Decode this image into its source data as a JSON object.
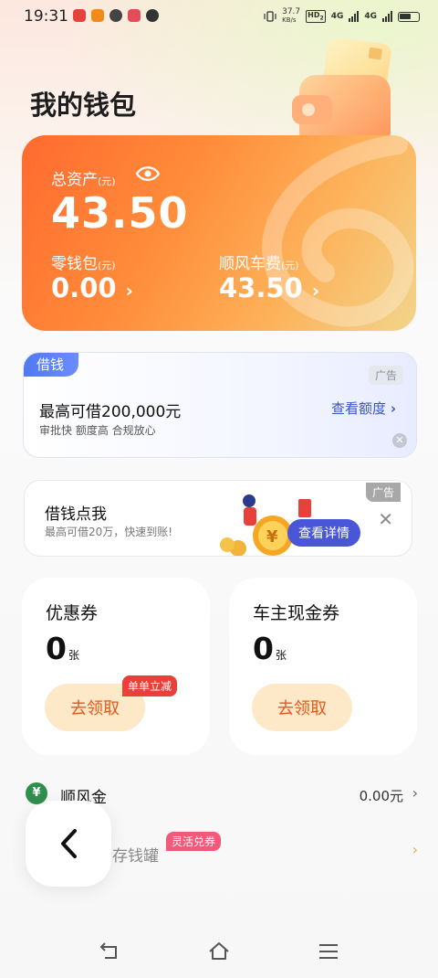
{
  "status_bar": {
    "time": "19:31",
    "net_speed": "37.7",
    "net_unit": "KB/s",
    "hd": "HD",
    "hd_sub": "2",
    "sim1": "4G",
    "sim2": "4G"
  },
  "header": {
    "title": "我的钱包"
  },
  "assets": {
    "total_label": "总资产",
    "unit": "(元)",
    "total_value": "43.50",
    "change_label": "零钱包",
    "change_value": "0.00",
    "fare_label": "顺风车费",
    "fare_value": "43.50"
  },
  "loan_ad": {
    "tag": "借钱",
    "ad": "广告",
    "title": "最高可借200,000元",
    "subtitle": "审批快 额度高 合规放心",
    "link": "查看额度"
  },
  "borrow_ad": {
    "title": "借钱点我",
    "subtitle": "最高可借20万，快速到账!",
    "button": "查看详情",
    "ad": "广告"
  },
  "coupons": [
    {
      "title": "优惠券",
      "count": "0",
      "unit": "张",
      "button": "去领取",
      "badge": "单单立减"
    },
    {
      "title": "车主现金券",
      "count": "0",
      "unit": "张",
      "button": "去领取"
    }
  ],
  "gold": {
    "icon_text": "¥",
    "label": "顺风金",
    "value": "0.00元"
  },
  "jar": {
    "label": "存钱罐",
    "badge": "灵活兑券"
  },
  "colors": {
    "accent": "#ff6a2f",
    "link": "#3a56c4",
    "badge_red": "#e8403a"
  }
}
